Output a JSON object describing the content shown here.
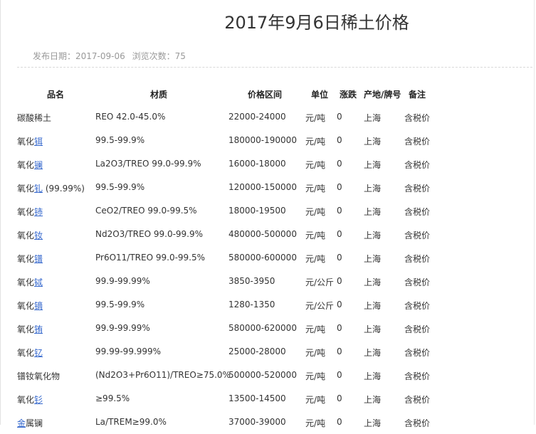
{
  "page": {
    "title": "2017年9月6日稀土价格",
    "publish_label": "发布日期：",
    "publish_date": "2017-09-06",
    "views_label": "浏览次数：",
    "views": "75"
  },
  "table": {
    "headers": [
      "品名",
      "材质",
      "价格区间",
      "单位",
      "涨跌",
      "产地/牌号",
      "备注"
    ],
    "rows": [
      {
        "name_prefix": "碳酸稀土",
        "name_link": "",
        "name_suffix": "",
        "material": "REO 42.0-45.0%",
        "price": "22000-24000",
        "unit": "元/吨",
        "change": "0",
        "origin": "上海",
        "note": "含税价"
      },
      {
        "name_prefix": "氧化",
        "name_link": "铒",
        "name_suffix": "",
        "material": "99.5-99.9%",
        "price": "180000-190000",
        "unit": "元/吨",
        "change": "0",
        "origin": "上海",
        "note": "含税价"
      },
      {
        "name_prefix": "氧化",
        "name_link": "镧",
        "name_suffix": "",
        "material": "La2O3/TREO 99.0-99.9%",
        "price": "16000-18000",
        "unit": "元/吨",
        "change": "0",
        "origin": "上海",
        "note": "含税价"
      },
      {
        "name_prefix": "氧化",
        "name_link": "钆",
        "name_suffix": " (99.99%)",
        "material": "99.5-99.9%",
        "price": "120000-150000",
        "unit": "元/吨",
        "change": "0",
        "origin": "上海",
        "note": "含税价"
      },
      {
        "name_prefix": "氧化",
        "name_link": "铈",
        "name_suffix": "",
        "material": "CeO2/TREO 99.0-99.5%",
        "price": "18000-19500",
        "unit": "元/吨",
        "change": "0",
        "origin": "上海",
        "note": "含税价"
      },
      {
        "name_prefix": "氧化",
        "name_link": "钕",
        "name_suffix": "",
        "material": "Nd2O3/TREO 99.0-99.9%",
        "price": "480000-500000",
        "unit": "元/吨",
        "change": "0",
        "origin": "上海",
        "note": "含税价"
      },
      {
        "name_prefix": "氧化",
        "name_link": "镨",
        "name_suffix": "",
        "material": "Pr6O11/TREO 99.0-99.5%",
        "price": "580000-600000",
        "unit": "元/吨",
        "change": "0",
        "origin": "上海",
        "note": "含税价"
      },
      {
        "name_prefix": "氧化",
        "name_link": "铽",
        "name_suffix": "",
        "material": "99.9-99.99%",
        "price": "3850-3950",
        "unit": "元/公斤",
        "change": "0",
        "origin": "上海",
        "note": "含税价"
      },
      {
        "name_prefix": "氧化",
        "name_link": "镝",
        "name_suffix": "",
        "material": "99.5-99.9%",
        "price": "1280-1350",
        "unit": "元/公斤",
        "change": "0",
        "origin": "上海",
        "note": "含税价"
      },
      {
        "name_prefix": "氧化",
        "name_link": "铕",
        "name_suffix": "",
        "material": "99.9-99.99%",
        "price": "580000-620000",
        "unit": "元/吨",
        "change": "0",
        "origin": "上海",
        "note": "含税价"
      },
      {
        "name_prefix": "氧化",
        "name_link": "钇",
        "name_suffix": "",
        "material": "99.99-99.999%",
        "price": "25000-28000",
        "unit": "元/吨",
        "change": "0",
        "origin": "上海",
        "note": "含税价"
      },
      {
        "name_prefix": "镨钕氧化物",
        "name_link": "",
        "name_suffix": "",
        "material": "(Nd2O3+Pr6O11)/TREO≥75.0%",
        "price": "500000-520000",
        "unit": "元/吨",
        "change": "0",
        "origin": "上海",
        "note": "含税价"
      },
      {
        "name_prefix": "氧化",
        "name_link": "钐",
        "name_suffix": "",
        "material": "≥99.5%",
        "price": "13500-14500",
        "unit": "元/吨",
        "change": "0",
        "origin": "上海",
        "note": "含税价"
      },
      {
        "name_prefix": "",
        "name_link": "金",
        "name_suffix": "属镧",
        "material": "La/TREM≥99.0%",
        "price": "37000-39000",
        "unit": "元/吨",
        "change": "0",
        "origin": "上海",
        "note": "含税价"
      }
    ]
  }
}
